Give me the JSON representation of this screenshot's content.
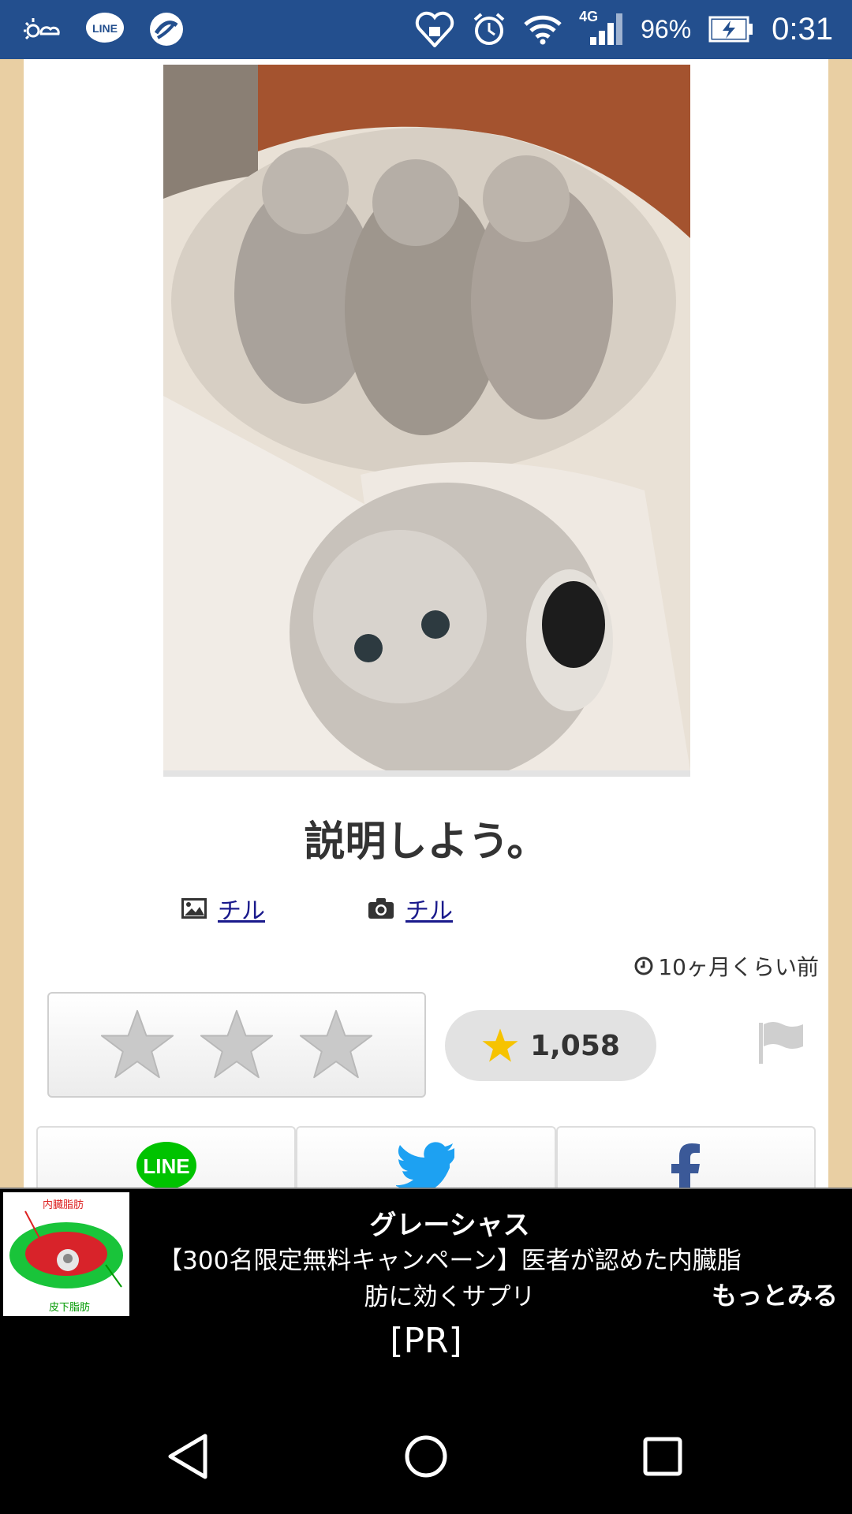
{
  "status_bar": {
    "battery": "96%",
    "time": "0:31",
    "network": "4G",
    "line_label": "LINE"
  },
  "post": {
    "title": "説明しよう。",
    "image_credit": "チル",
    "photo_credit": "チル",
    "time_ago": "10ヶ月くらい前",
    "favorite_count": "1,058"
  },
  "share": {
    "line_label": "LINE"
  },
  "ad": {
    "title": "グレーシャス",
    "body": "【300名限定無料キャンペーン】医者が認めた内臓脂肪に効くサプリ",
    "more": "もっとみる",
    "thumb_top_label": "内臓脂肪",
    "thumb_bottom_label": "皮下脂肪",
    "pr_label": "[PR]"
  },
  "colors": {
    "status_bar": "#234f8e",
    "line_green": "#00c300",
    "twitter_blue": "#1da1f2",
    "facebook_blue": "#3b5998",
    "star_gold": "#f6c300"
  }
}
